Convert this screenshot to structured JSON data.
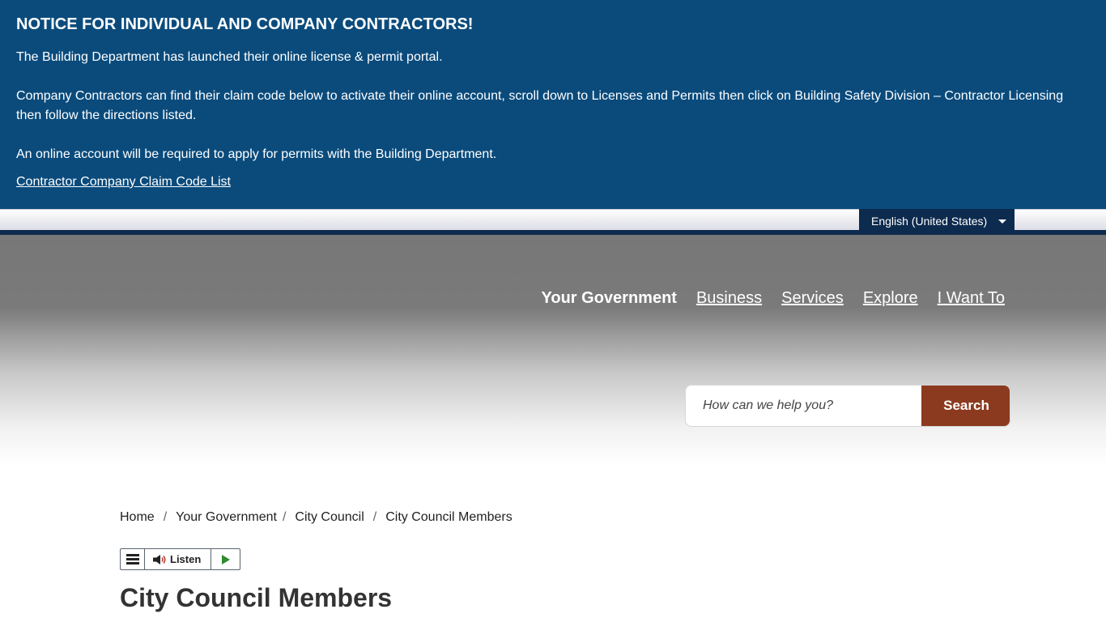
{
  "notice": {
    "title": "NOTICE FOR INDIVIDUAL AND COMPANY CONTRACTORS!",
    "paragraph1": "The Building Department has launched their online license & permit portal.",
    "paragraph2": "Company Contractors can find their claim code below to activate their online account, scroll down to Licenses and Permits then click on Building Safety Division – Contractor Licensing then follow the directions listed.",
    "paragraph3": "An online account will be required to apply for permits with the Building Department.",
    "link": "Contractor Company Claim Code List",
    "background_color": "#0a4b7c"
  },
  "language": {
    "selected": "English (United States)"
  },
  "nav": {
    "items": [
      {
        "label": "Your Government"
      },
      {
        "label": "Business"
      },
      {
        "label": "Services"
      },
      {
        "label": "Explore"
      },
      {
        "label": "I Want To"
      }
    ]
  },
  "search": {
    "placeholder": "How can we help you?",
    "button_label": "Search",
    "button_color": "#8b3a1f"
  },
  "breadcrumb": {
    "items": [
      {
        "label": "Home"
      },
      {
        "label": "Your Government"
      },
      {
        "label": "City Council"
      },
      {
        "label": "City Council Members"
      }
    ],
    "separator": "/"
  },
  "listen": {
    "label": "Listen"
  },
  "page": {
    "title": "City Council Members"
  }
}
